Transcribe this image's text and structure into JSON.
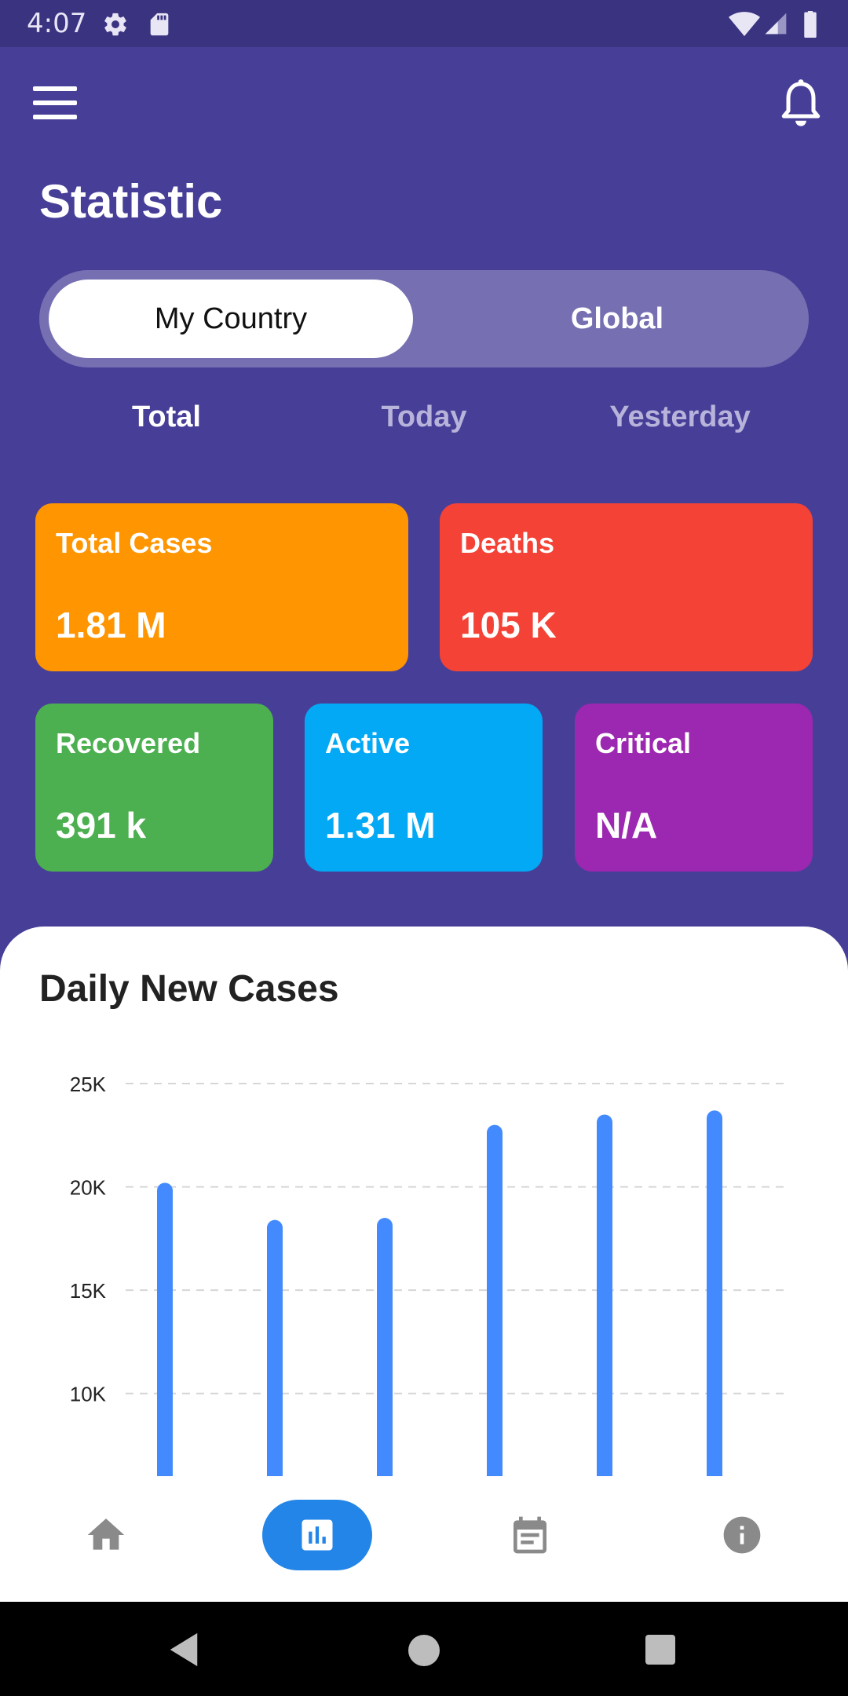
{
  "status_bar": {
    "time": "4:07",
    "icons": [
      "gear-icon",
      "sd-card-icon",
      "wifi-icon",
      "signal-icon",
      "battery-icon"
    ]
  },
  "header": {
    "menu_icon": "hamburger-menu-icon",
    "notification_icon": "bell-icon",
    "title": "Statistic"
  },
  "segment_control": {
    "options": [
      "My Country",
      "Global"
    ],
    "selected": "My Country"
  },
  "period_tabs": {
    "items": [
      "Total",
      "Today",
      "Yesterday"
    ],
    "selected": "Total"
  },
  "stats": {
    "total_cases": {
      "label": "Total Cases",
      "value": "1.81 M",
      "color": "#FF9500"
    },
    "deaths": {
      "label": "Deaths",
      "value": "105 K",
      "color": "#F44336"
    },
    "recovered": {
      "label": "Recovered",
      "value": "391 k",
      "color": "#4CAF50"
    },
    "active": {
      "label": "Active",
      "value": "1.31 M",
      "color": "#03A9F4"
    },
    "critical": {
      "label": "Critical",
      "value": "N/A",
      "color": "#9C27B0"
    }
  },
  "chart_section": {
    "title": "Daily New Cases"
  },
  "chart_data": {
    "type": "bar",
    "title": "Daily New Cases",
    "xlabel": "",
    "ylabel": "",
    "ytick_labels": [
      "25K",
      "20K",
      "15K",
      "10K"
    ],
    "yticks": [
      25000,
      20000,
      15000,
      10000
    ],
    "ylim": [
      6000,
      25000
    ],
    "grid": true,
    "bar_color": "#448AFF",
    "values": [
      20200,
      18400,
      18500,
      23000,
      23500,
      23700
    ]
  },
  "bottom_nav": {
    "items": [
      "home-icon",
      "bar-chart-icon",
      "calendar-icon",
      "info-icon"
    ],
    "selected": "bar-chart-icon",
    "accent": "#2385E8"
  },
  "system_nav": {
    "items": [
      "back-icon",
      "home-circle-icon",
      "recents-square-icon"
    ]
  },
  "colors": {
    "background": "#473F97",
    "status_bar": "#3A3380",
    "segment_track": "#7670B2"
  }
}
